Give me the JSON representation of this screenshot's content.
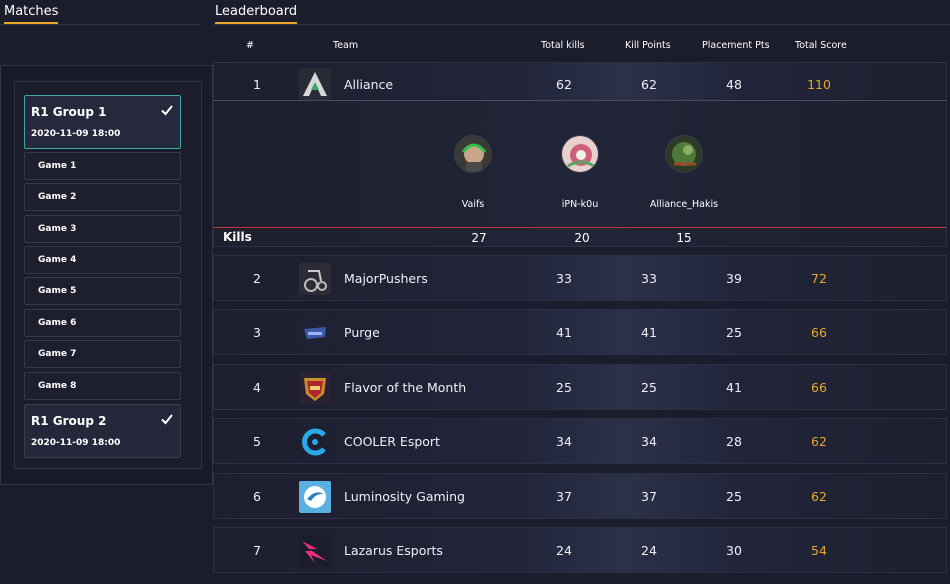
{
  "tabs": {
    "matches": "Matches",
    "leaderboard": "Leaderboard"
  },
  "accent_color": "#e8a72a",
  "selected_border_color": "#3aa8a6",
  "matches": {
    "groups": [
      {
        "title": "R1 Group 1",
        "date": "2020-11-09 18:00",
        "completed": true,
        "selected": true,
        "games": [
          "Game 1",
          "Game 2",
          "Game 3",
          "Game 4",
          "Game 5",
          "Game 6",
          "Game 7",
          "Game 8"
        ]
      },
      {
        "title": "R1 Group 2",
        "date": "2020-11-09 18:00",
        "completed": true,
        "selected": false
      }
    ]
  },
  "leaderboard": {
    "columns": {
      "rank": "#",
      "team": "Team",
      "total_kills": "Total kills",
      "kill_points": "Kill Points",
      "placement_pts": "Placement Pts",
      "total_score": "Total Score"
    },
    "rows": [
      {
        "rank": "1",
        "team": "Alliance",
        "total_kills": "62",
        "kill_points": "62",
        "placement_pts": "48",
        "total_score": "110",
        "logo": "alliance-logo"
      },
      {
        "rank": "2",
        "team": "MajorPushers",
        "total_kills": "33",
        "kill_points": "33",
        "placement_pts": "39",
        "total_score": "72",
        "logo": "majorpushers-logo"
      },
      {
        "rank": "3",
        "team": "Purge",
        "total_kills": "41",
        "kill_points": "41",
        "placement_pts": "25",
        "total_score": "66",
        "logo": "purge-logo"
      },
      {
        "rank": "4",
        "team": "Flavor of the Month",
        "total_kills": "25",
        "kill_points": "25",
        "placement_pts": "41",
        "total_score": "66",
        "logo": "flavor-logo"
      },
      {
        "rank": "5",
        "team": "COOLER Esport",
        "total_kills": "34",
        "kill_points": "34",
        "placement_pts": "28",
        "total_score": "62",
        "logo": "cooler-logo"
      },
      {
        "rank": "6",
        "team": "Luminosity Gaming",
        "total_kills": "37",
        "kill_points": "37",
        "placement_pts": "25",
        "total_score": "62",
        "logo": "luminosity-logo"
      },
      {
        "rank": "7",
        "team": "Lazarus Esports",
        "total_kills": "24",
        "kill_points": "24",
        "placement_pts": "30",
        "total_score": "54",
        "logo": "lazarus-logo"
      }
    ],
    "expanded": {
      "kills_label": "Kills",
      "players": [
        {
          "name": "Vaifs",
          "kills": "27"
        },
        {
          "name": "iPN-k0u",
          "kills": "20"
        },
        {
          "name": "Alliance_Hakis",
          "kills": "15"
        }
      ]
    }
  }
}
